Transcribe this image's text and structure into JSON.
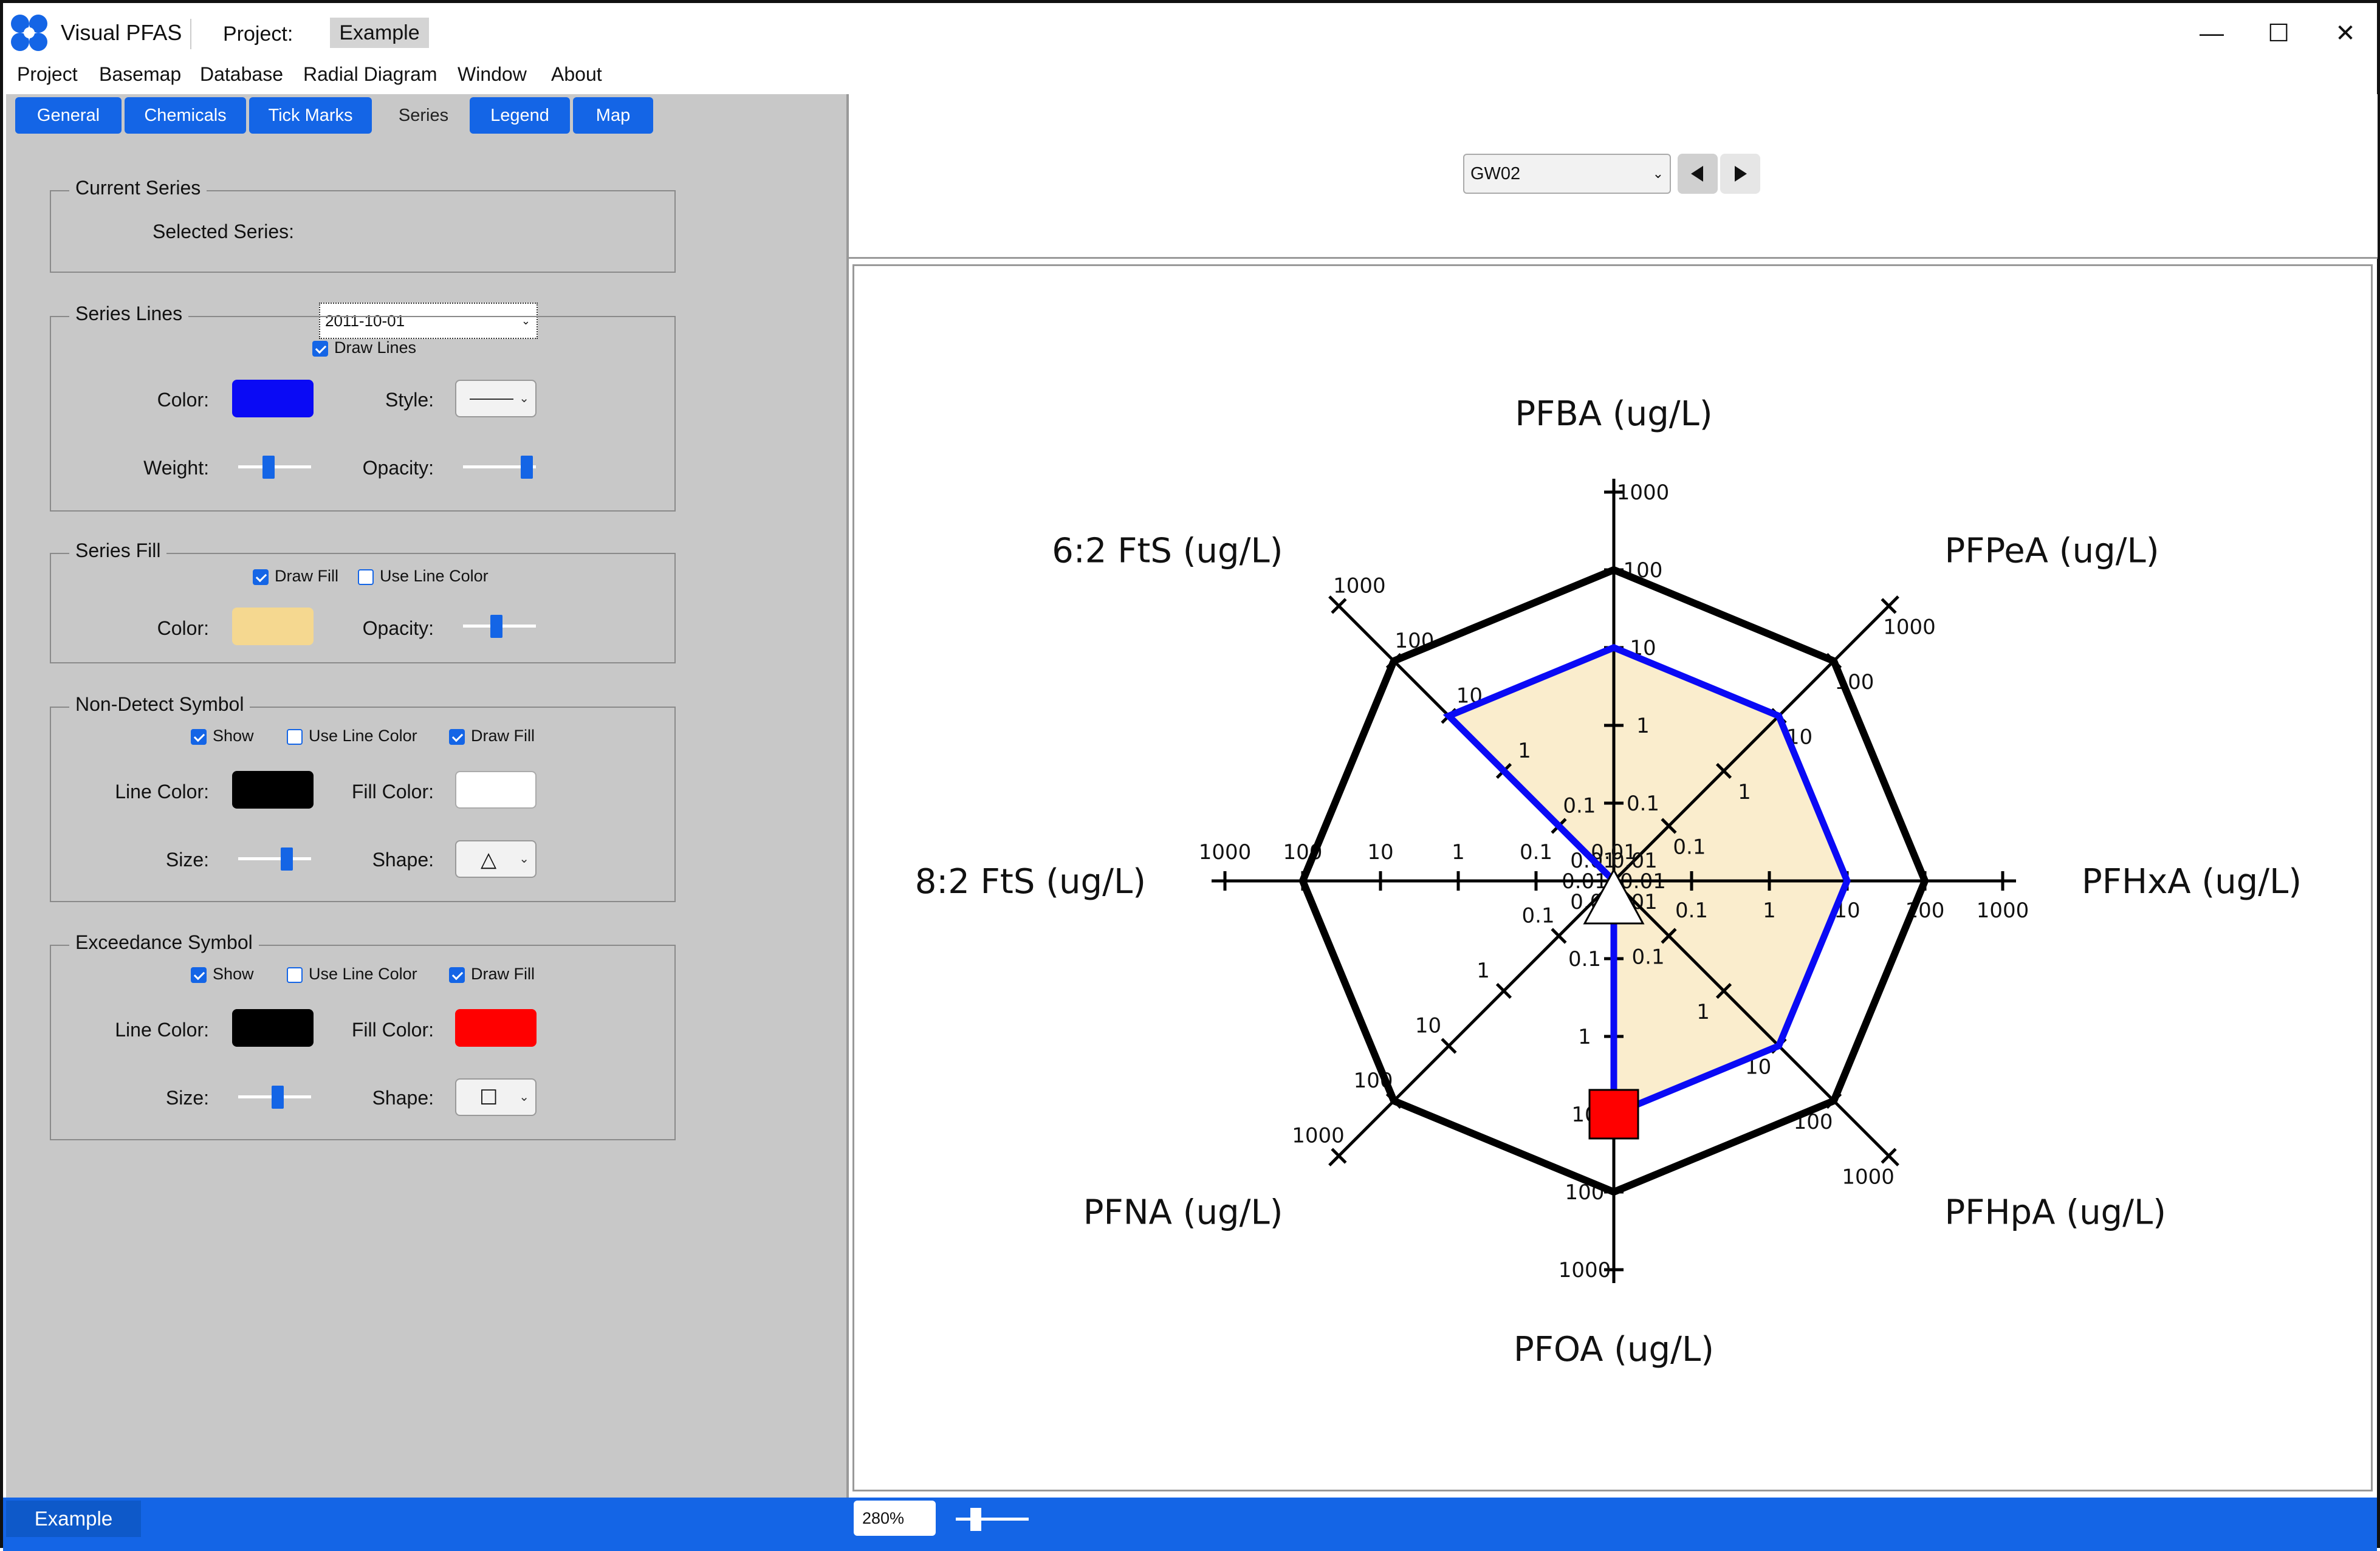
{
  "window": {
    "app_title": "Visual PFAS",
    "project_label": "Project:",
    "project_name": "Example",
    "minimize": "—",
    "maximize": "☐",
    "close": "✕"
  },
  "menu": [
    "Project",
    "Basemap",
    "Database",
    "Radial Diagram",
    "Window",
    "About"
  ],
  "tabs": [
    {
      "label": "General",
      "active": false
    },
    {
      "label": "Chemicals",
      "active": false
    },
    {
      "label": "Tick Marks",
      "active": false
    },
    {
      "label": "Series",
      "active": true
    },
    {
      "label": "Legend",
      "active": false
    },
    {
      "label": "Map",
      "active": false
    }
  ],
  "current_series": {
    "title": "Current Series",
    "selected_label": "Selected Series:",
    "selected_value": "2011-10-01"
  },
  "series_lines": {
    "title": "Series Lines",
    "draw_lines": "Draw Lines",
    "color_label": "Color:",
    "color": "#0a0af5",
    "style_label": "Style:",
    "weight_label": "Weight:",
    "opacity_label": "Opacity:",
    "weight_level": 0.4,
    "opacity_level": 0.95
  },
  "series_fill": {
    "title": "Series Fill",
    "draw_fill": "Draw Fill",
    "use_line_color": "Use Line Color",
    "color_label": "Color:",
    "color": "#f5d890",
    "opacity_label": "Opacity:",
    "opacity_level": 0.45
  },
  "non_detect": {
    "title": "Non-Detect Symbol",
    "show": "Show",
    "use_line_color": "Use Line Color",
    "draw_fill": "Draw Fill",
    "line_color_label": "Line Color:",
    "line_color": "#000000",
    "fill_color_label": "Fill Color:",
    "fill_color": "#ffffff",
    "size_label": "Size:",
    "shape_label": "Shape:",
    "shape": "△",
    "size_level": 0.7
  },
  "exceedance": {
    "title": "Exceedance Symbol",
    "show": "Show",
    "use_line_color": "Use Line Color",
    "draw_fill": "Draw Fill",
    "line_color_label": "Line Color:",
    "line_color": "#000000",
    "fill_color_label": "Fill Color:",
    "fill_color": "#ff0000",
    "size_label": "Size:",
    "shape_label": "Shape:",
    "shape": "☐",
    "size_level": 0.55
  },
  "location_select": "GW02",
  "status": {
    "project": "Example",
    "zoom": "280%"
  },
  "chart_data": {
    "type": "radar",
    "scale": "log",
    "axis_range": [
      0.01,
      1000
    ],
    "tick_labels": [
      "0.01",
      "0.1",
      "1",
      "10",
      "100",
      "1000"
    ],
    "axes": [
      "PFBA (ug/L)",
      "PFPeA (ug/L)",
      "PFHxA (ug/L)",
      "PFHpA (ug/L)",
      "PFOA (ug/L)",
      "PFNA (ug/L)",
      "8:2 FtS (ug/L)",
      "6:2 FtS (ug/L)"
    ],
    "screening_level": [
      100,
      100,
      100,
      100,
      100,
      100,
      100,
      100
    ],
    "series": [
      {
        "name": "2011-10-01",
        "values": [
          10,
          10,
          10,
          10,
          10,
          0.01,
          0.01,
          10
        ],
        "line_color": "#0a0af5",
        "fill_color": "#f5d890"
      }
    ],
    "non_detect_axes": [
      "PFNA (ug/L)"
    ],
    "exceedance_axes": [
      "PFOA (ug/L)"
    ]
  }
}
